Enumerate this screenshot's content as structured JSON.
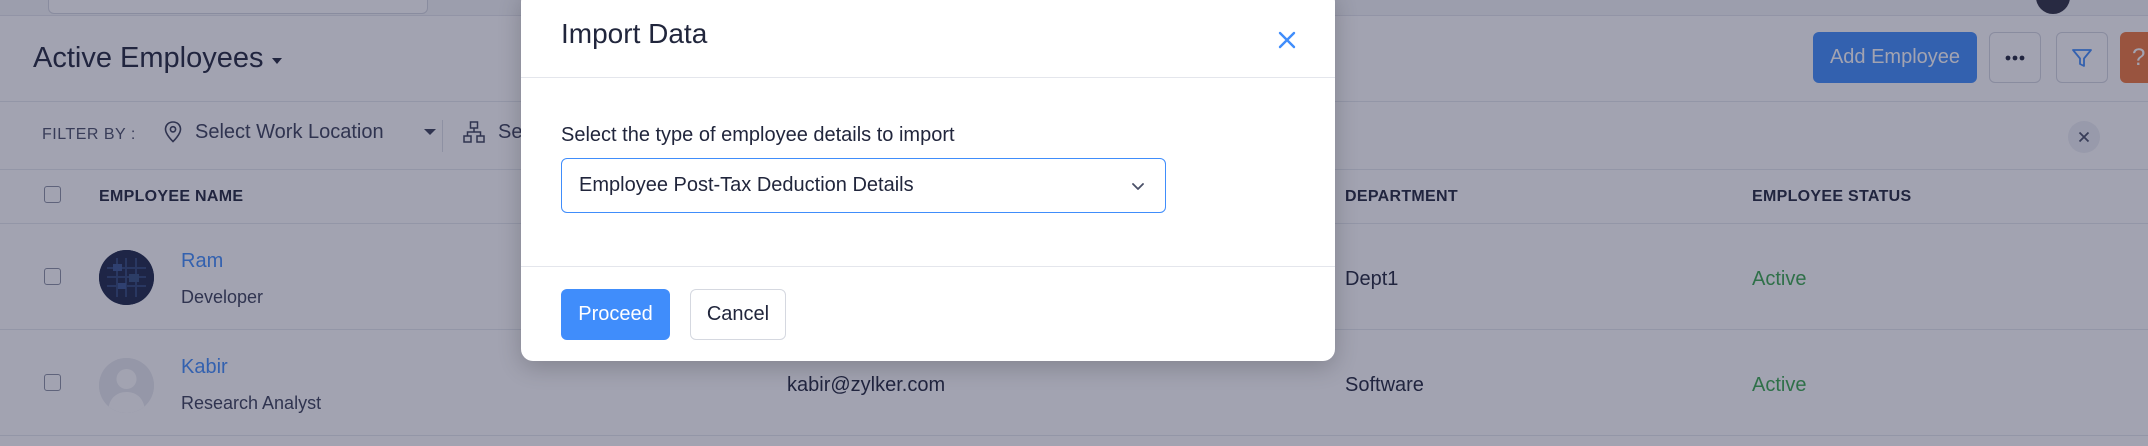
{
  "header": {
    "title": "Active Employees",
    "add_label": "Add Employee",
    "more_icon": "more-horizontal-icon",
    "filter_icon": "filter-icon",
    "help_label": "?"
  },
  "filters": {
    "label": "FILTER BY :",
    "location_placeholder": "Select Work Location",
    "department_placeholder": "Se"
  },
  "table": {
    "columns": {
      "name": "EMPLOYEE NAME",
      "department": "DEPARTMENT",
      "status": "EMPLOYEE STATUS"
    },
    "rows": [
      {
        "name": "Ram",
        "role": "Developer",
        "email": "",
        "department": "Dept1",
        "status": "Active"
      },
      {
        "name": "Kabir",
        "role": "Research Analyst",
        "email": "kabir@zylker.com",
        "department": "Software",
        "status": "Active"
      }
    ]
  },
  "modal": {
    "title": "Import Data",
    "field_label": "Select the type of employee details to import",
    "selected_value": "Employee Post-Tax Deduction Details",
    "proceed_label": "Proceed",
    "cancel_label": "Cancel"
  },
  "colors": {
    "accent": "#408dfb",
    "status_active": "#3aa74c",
    "help": "#f0783c",
    "overlay": "rgba(34,36,70,0.42)"
  }
}
